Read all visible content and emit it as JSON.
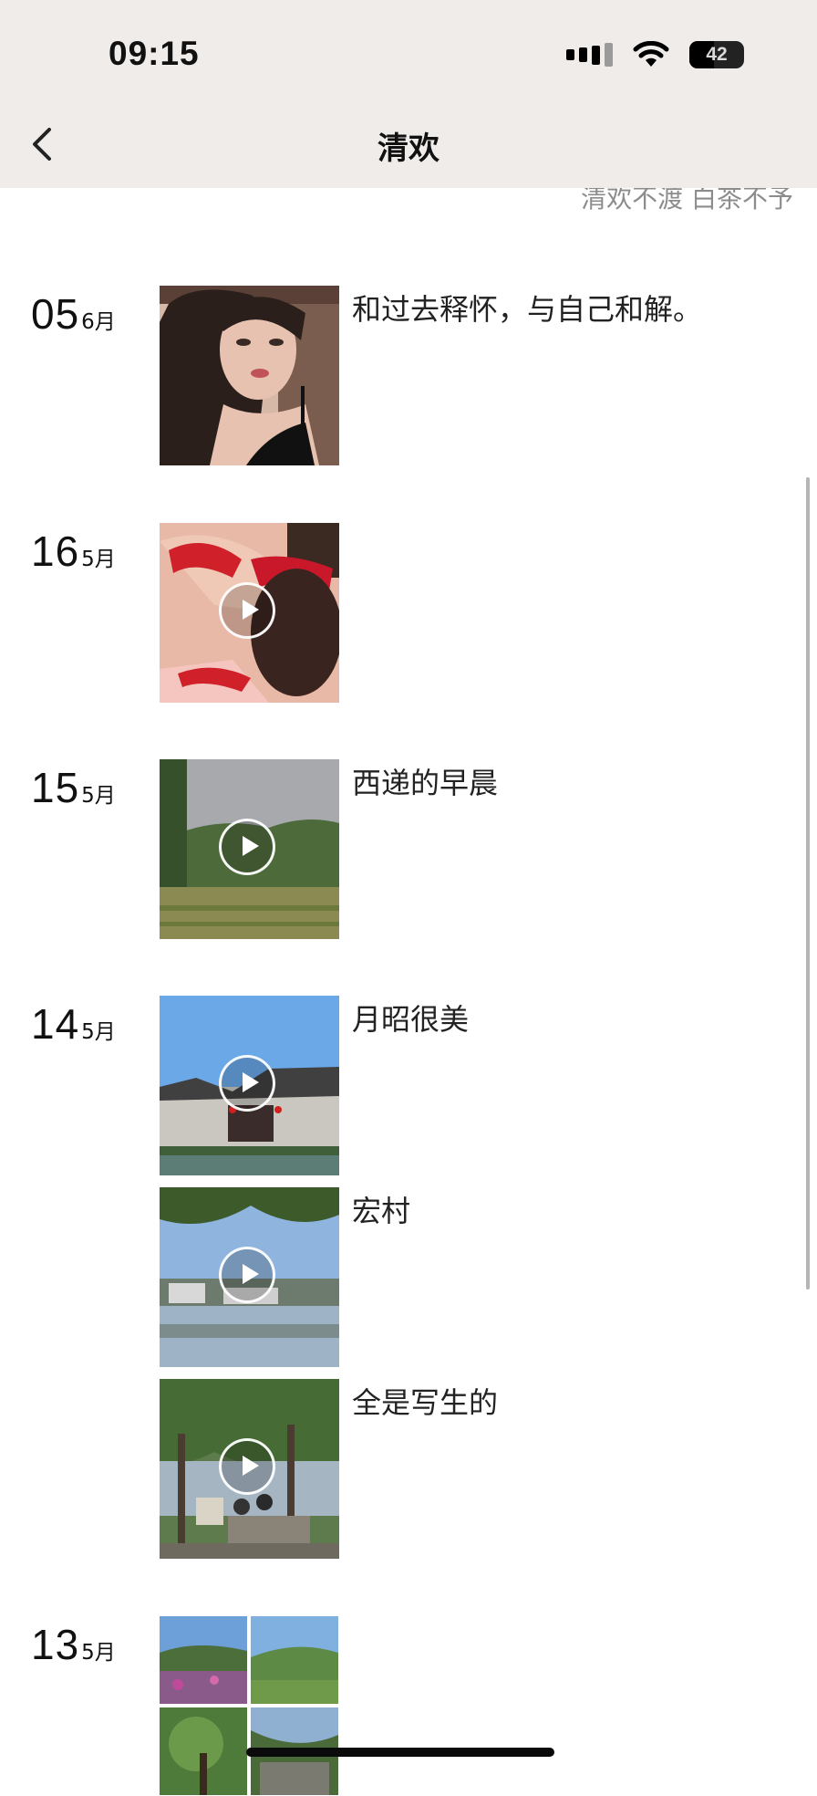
{
  "status_bar": {
    "time": "09:15",
    "battery": "42"
  },
  "header": {
    "title": "清欢",
    "subtitle": "清欢不渡 白茶不予"
  },
  "entries": [
    {
      "day": "05",
      "month": "6月",
      "posts": [
        {
          "caption": "和过去释怀，与自己和解。",
          "media": "photo"
        }
      ]
    },
    {
      "day": "16",
      "month": "5月",
      "posts": [
        {
          "caption": "",
          "media": "video"
        }
      ]
    },
    {
      "day": "15",
      "month": "5月",
      "posts": [
        {
          "caption": "西递的早晨",
          "media": "video"
        }
      ]
    },
    {
      "day": "14",
      "month": "5月",
      "posts": [
        {
          "caption": "月昭很美",
          "media": "video"
        },
        {
          "caption": "宏村",
          "media": "video"
        },
        {
          "caption": "全是写生的",
          "media": "video"
        }
      ]
    },
    {
      "day": "13",
      "month": "5月",
      "posts": [
        {
          "caption": "",
          "media": "photo-grid"
        }
      ]
    }
  ]
}
